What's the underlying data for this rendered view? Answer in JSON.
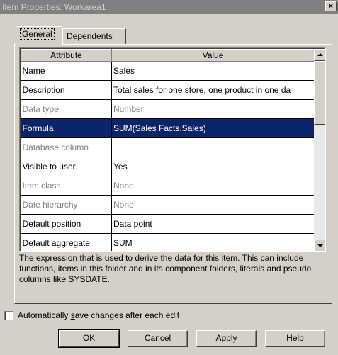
{
  "window": {
    "title": "Item Properties: Workarea1",
    "close_glyph": "×"
  },
  "tabs": [
    {
      "label": "General",
      "active": true
    },
    {
      "label": "Dependents",
      "active": false
    }
  ],
  "grid": {
    "headers": {
      "attribute": "Attribute",
      "value": "Value"
    },
    "rows": [
      {
        "attribute": "Name",
        "value": "Sales",
        "state": "normal"
      },
      {
        "attribute": "Description",
        "value": "Total sales for one store, one product in one da",
        "state": "normal"
      },
      {
        "attribute": "Data type",
        "value": "Number",
        "state": "disabled"
      },
      {
        "attribute": "Formula",
        "value": "SUM(Sales Facts.Sales)",
        "state": "selected"
      },
      {
        "attribute": "Database column",
        "value": "",
        "state": "disabled"
      },
      {
        "attribute": "Visible to user",
        "value": "Yes",
        "state": "normal"
      },
      {
        "attribute": "Item class",
        "value": "None",
        "state": "disabled"
      },
      {
        "attribute": "Date hierarchy",
        "value": "None",
        "state": "disabled"
      },
      {
        "attribute": "Default position",
        "value": "Data point",
        "state": "normal"
      },
      {
        "attribute": "Default aggregate",
        "value": "SUM",
        "state": "normal"
      }
    ],
    "selection_color": "#0a246a"
  },
  "description": "The expression that is used to derive the data for this item. This can include functions, items in this folder and in its component folders, literals and pseudo columns like SYSDATE.",
  "autosave": {
    "label_before": "Automatically ",
    "label_mnemonic": "s",
    "label_after": "ave changes after each edit",
    "checked": false
  },
  "buttons": {
    "ok": "OK",
    "cancel": "Cancel",
    "apply": {
      "mnemonic": "A",
      "rest": "pply"
    },
    "help": {
      "mnemonic": "H",
      "rest": "elp"
    }
  },
  "icons": {
    "scroll_up": "scroll-up-arrow-icon",
    "scroll_down": "scroll-down-arrow-icon"
  }
}
